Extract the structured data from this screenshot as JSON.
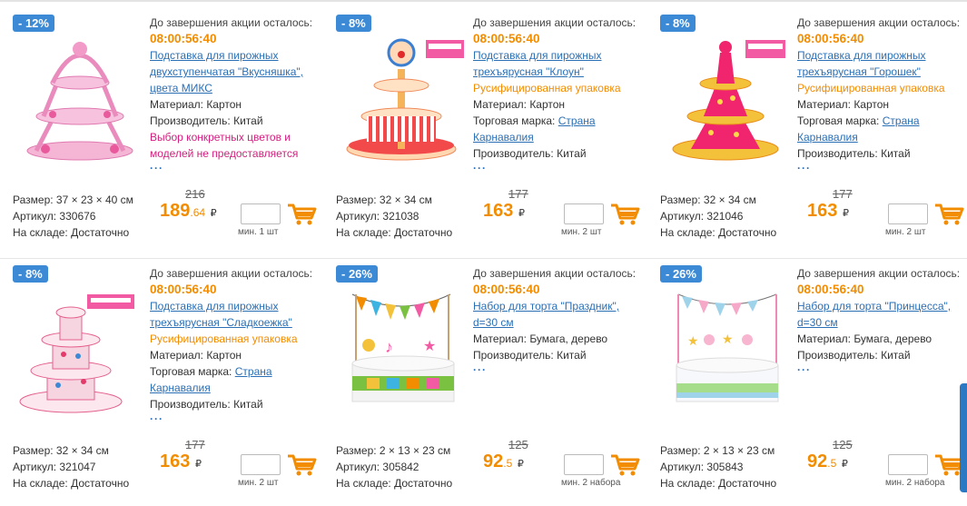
{
  "ui": {
    "promo_label": "До завершения акции осталось:",
    "material_prefix": "Материал:",
    "maker_prefix": "Производитель:",
    "brand_prefix": "Торговая марка:",
    "size_prefix": "Размер:",
    "sku_prefix": "Артикул:",
    "stock_prefix": "На складе:",
    "more": "···",
    "ruble": "₽",
    "colors": {
      "accent": "#f28c00",
      "link": "#2b6fb5",
      "badge": "#3c8ad6",
      "warning": "#d1207e"
    }
  },
  "products": [
    {
      "discount": "- 12%",
      "timer": "08:00:56:40",
      "title": "Подставка для пирожных двухступенчатая \"Вкусняшка\", цвета МИКС",
      "material": "Картон",
      "brand": "",
      "maker": "Китай",
      "note": "",
      "warning": "Выбор конкретных цветов и моделей не предоставляется",
      "size": "37 × 23 × 40 см",
      "sku": "330676",
      "stock": "Достаточно",
      "old_price": "216",
      "price": "189",
      "cents": ".64",
      "min_qty": "мин. 1 шт",
      "image_icon": "pink-cake-stand-icon"
    },
    {
      "discount": "- 8%",
      "timer": "08:00:56:40",
      "title": "Подставка для пирожных трехъярусная \"Клоун\"",
      "material": "Картон",
      "brand": "Страна Карнавалия",
      "maker": "Китай",
      "note": "Русифицированная упаковка",
      "warning": "",
      "size": "32 × 34 см",
      "sku": "321038",
      "stock": "Достаточно",
      "old_price": "177",
      "price": "163",
      "cents": "",
      "min_qty": "мин. 2 шт",
      "image_icon": "clown-cake-stand-icon"
    },
    {
      "discount": "- 8%",
      "timer": "08:00:56:40",
      "title": "Подставка для пирожных трехъярусная \"Горошек\"",
      "material": "Картон",
      "brand": "Страна Карнавалия",
      "maker": "Китай",
      "note": "Русифицированная упаковка",
      "warning": "",
      "size": "32 × 34 см",
      "sku": "321046",
      "stock": "Достаточно",
      "old_price": "177",
      "price": "163",
      "cents": "",
      "min_qty": "мин. 2 шт",
      "image_icon": "polka-dot-cake-stand-icon"
    },
    {
      "discount": "- 8%",
      "timer": "08:00:56:40",
      "title": "Подставка для пирожных трехъярусная \"Сладкоежка\"",
      "material": "Картон",
      "brand": "Страна Карнавалия",
      "maker": "Китай",
      "note": "Русифицированная упаковка",
      "warning": "",
      "size": "32 × 34 см",
      "sku": "321047",
      "stock": "Достаточно",
      "old_price": "177",
      "price": "163",
      "cents": "",
      "min_qty": "мин. 2 шт",
      "image_icon": "sweet-cake-stand-icon"
    },
    {
      "discount": "- 26%",
      "timer": "08:00:56:40",
      "title": "Набор для торта \"Праздник\", d=30 см",
      "material": "Бумага, дерево",
      "brand": "",
      "maker": "Китай",
      "note": "",
      "warning": "",
      "size": "2 × 13 × 23 см",
      "sku": "305842",
      "stock": "Достаточно",
      "old_price": "125",
      "price": "92",
      "cents": ".5",
      "min_qty": "мин. 2 набора",
      "image_icon": "holiday-cake-topper-icon"
    },
    {
      "discount": "- 26%",
      "timer": "08:00:56:40",
      "title": "Набор для торта \"Принцесса\", d=30 см",
      "material": "Бумага, дерево",
      "brand": "",
      "maker": "Китай",
      "note": "",
      "warning": "",
      "size": "2 × 13 × 23 см",
      "sku": "305843",
      "stock": "Достаточно",
      "old_price": "125",
      "price": "92",
      "cents": ".5",
      "min_qty": "мин. 2 набора",
      "image_icon": "princess-cake-topper-icon"
    }
  ]
}
